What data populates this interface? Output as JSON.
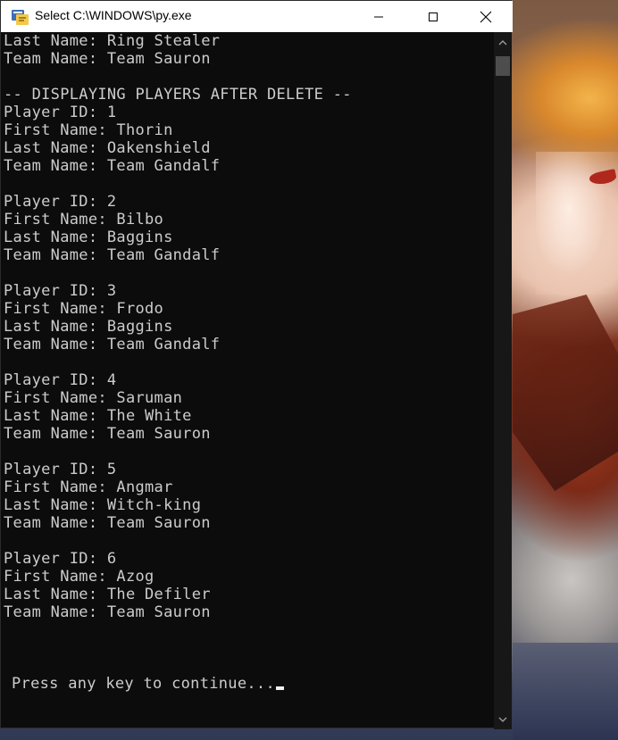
{
  "window": {
    "title": "Select C:\\WINDOWS\\py.exe",
    "icon": "python-launcher-icon",
    "buttons": [
      "minimize-icon",
      "maximize-icon",
      "close-icon"
    ]
  },
  "console": {
    "lines": [
      "Last Name: Ring Stealer",
      "Team Name: Team Sauron",
      "",
      "-- DISPLAYING PLAYERS AFTER DELETE --",
      "Player ID: 1",
      "First Name: Thorin",
      "Last Name: Oakenshield",
      "Team Name: Team Gandalf",
      "",
      "Player ID: 2",
      "First Name: Bilbo",
      "Last Name: Baggins",
      "Team Name: Team Gandalf",
      "",
      "Player ID: 3",
      "First Name: Frodo",
      "Last Name: Baggins",
      "Team Name: Team Gandalf",
      "",
      "Player ID: 4",
      "First Name: Saruman",
      "Last Name: The White",
      "Team Name: Team Sauron",
      "",
      "Player ID: 5",
      "First Name: Angmar",
      "Last Name: Witch-king",
      "Team Name: Team Sauron",
      "",
      "Player ID: 6",
      "First Name: Azog",
      "Last Name: The Defiler",
      "Team Name: Team Sauron"
    ],
    "prompt": "Press any key to continue..."
  },
  "colors": {
    "console_bg": "#0c0c0c",
    "console_text": "#cccccc",
    "titlebar_bg": "#ffffff"
  }
}
